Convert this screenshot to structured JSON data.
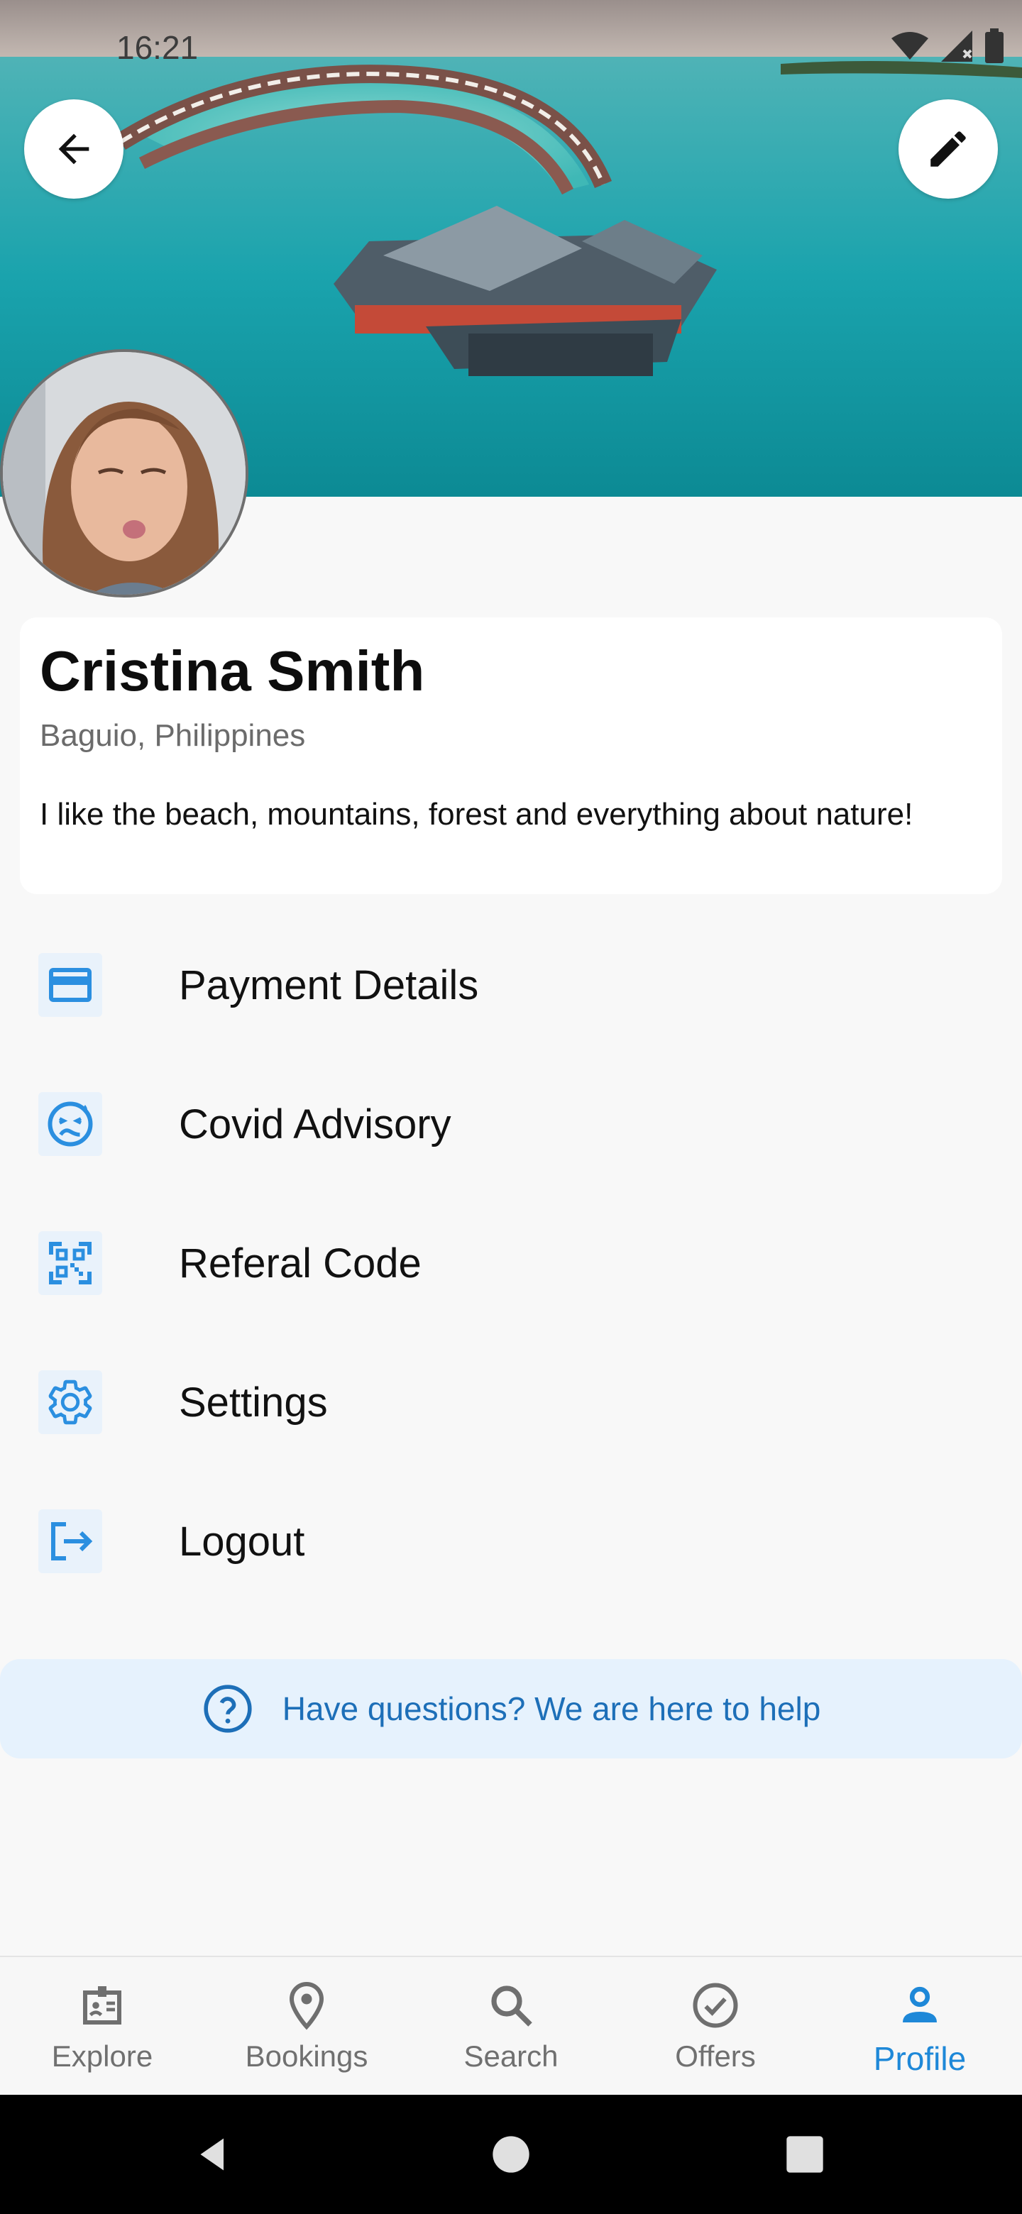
{
  "status_bar": {
    "time": "16:21"
  },
  "hero": {
    "back_icon": "arrow-left-icon",
    "edit_icon": "pencil-icon"
  },
  "profile": {
    "name": "Cristina Smith",
    "location": "Baguio, Philippines",
    "bio": "I like the beach, mountains, forest and everything about nature!"
  },
  "menu": {
    "items": [
      {
        "label": "Payment Details",
        "icon": "credit-card-icon"
      },
      {
        "label": "Covid Advisory",
        "icon": "sick-face-icon"
      },
      {
        "label": "Referal Code",
        "icon": "qr-code-icon"
      },
      {
        "label": "Settings",
        "icon": "gear-icon"
      },
      {
        "label": "Logout",
        "icon": "logout-icon"
      }
    ]
  },
  "help": {
    "text": "Have questions? We are here to help",
    "icon": "question-circle-icon"
  },
  "bottom_nav": {
    "items": [
      {
        "label": "Explore",
        "icon": "badge-icon"
      },
      {
        "label": "Bookings",
        "icon": "map-pin-icon"
      },
      {
        "label": "Search",
        "icon": "search-icon"
      },
      {
        "label": "Offers",
        "icon": "check-circle-icon"
      },
      {
        "label": "Profile",
        "icon": "person-icon",
        "active": true
      }
    ]
  },
  "colors": {
    "accent": "#1e88d8",
    "icon_blue": "#2b8fe0",
    "help_bg": "#e6f2fd"
  }
}
